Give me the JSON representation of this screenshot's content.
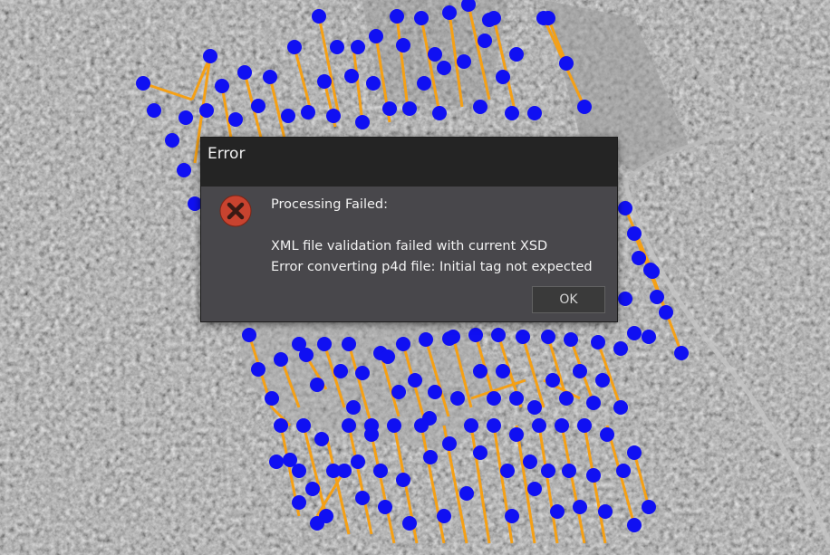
{
  "dialog": {
    "title": "Error",
    "icon": "error-x-icon",
    "message_heading": "Processing Failed:",
    "message_lines": [
      "XML file validation failed with current XSD",
      "Error converting p4d file: Initial tag not expected"
    ],
    "ok_label": "OK"
  },
  "map": {
    "type": "aerial-imagery-grayscale",
    "flight_path_color": "#f5a015",
    "waypoint_color": "#1010f2"
  },
  "colors": {
    "dialog_bg": "#48474b",
    "titlebar_bg": "#242424",
    "icon_red": "#c8432f"
  }
}
